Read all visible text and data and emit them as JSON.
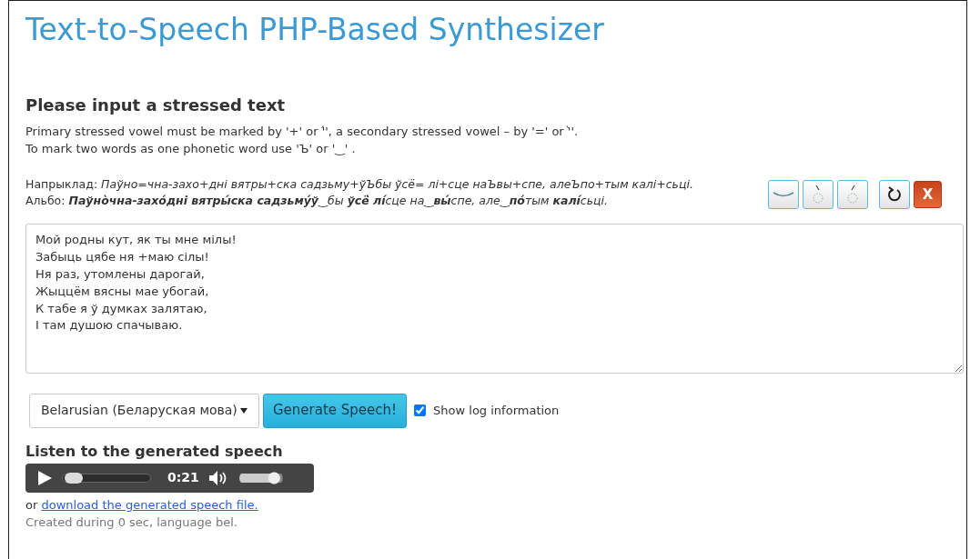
{
  "title": "Text-to-Speech PHP-Based Synthesizer",
  "input_heading": "Please input a stressed text",
  "instructions": [
    "Primary stressed vowel must be marked by '+' or '́', a secondary stressed vowel – by '=' or '̀'.",
    "To mark two words as one phonetic word use 'Ъ' or '‿' ."
  ],
  "examples": [
    {
      "label": "Напрыклад:",
      "text": "Паўно=чна-захо+дні вятры+ска садзьму+ўЪбы ўсё= лі+сце наЪвы+спе, алеЪпо+тым калі+сьці."
    },
    {
      "label": "Альбо:",
      "text": "**Паўно̀чна-захо́дні вятры́ска садзьму́ў**‿бы **ўсё̀ лі́**сце на‿**вы́**спе, але‿**по́**тым **калі́**сьці."
    }
  ],
  "tool_buttons": [
    {
      "kind": "undertie"
    },
    {
      "kind": "grave"
    },
    {
      "kind": "acute"
    },
    {
      "kind": "undo"
    },
    {
      "kind": "clear",
      "label": "X"
    }
  ],
  "text_value": "Мой родны кут, як ты мне мілы!\nЗабыць цябе ня +маю сілы!\nНя раз, утомлены дарогай,\nЖыццём вясны мае убогай,\nК табе я ў думках залятаю,\nІ там душою спачываю.",
  "language": "Belarusian (Беларуская мова)",
  "generate_button": "Generate Speech!",
  "show_log": {
    "label": "Show log information",
    "checked": true
  },
  "listen_heading": "Listen to the generated speech",
  "player": {
    "time": "0:21",
    "progress": {
      "level": 0.03
    },
    "volume": {
      "level": 0.92
    }
  },
  "download": {
    "prefix": "or",
    "link": "download the generated speech file."
  },
  "log_line": "Created during 0 sec, language bel."
}
